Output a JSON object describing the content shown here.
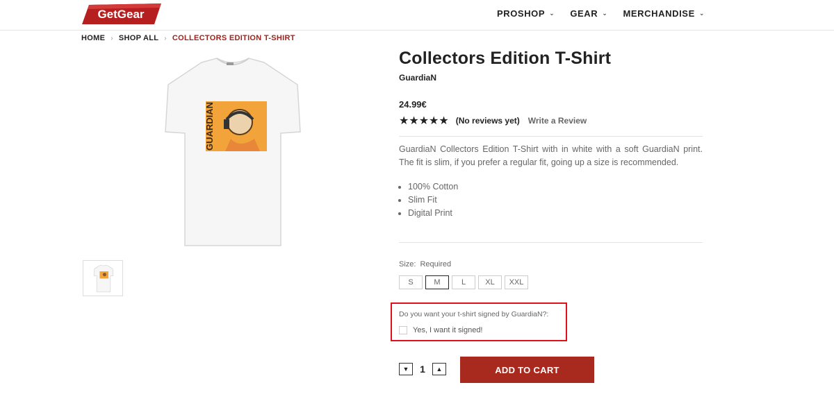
{
  "header": {
    "logo_text": "GetGear",
    "nav": [
      {
        "label": "PROSHOP"
      },
      {
        "label": "GEAR"
      },
      {
        "label": "MERCHANDISE"
      }
    ]
  },
  "breadcrumb": [
    "HOME",
    "SHOP ALL",
    "COLLECTORS EDITION T-SHIRT"
  ],
  "product": {
    "title": "Collectors Edition T-Shirt",
    "brand": "GuardiaN",
    "price": "24.99€",
    "stars": "★★★★★",
    "rating_value": 5,
    "reviews_text": "(No reviews yet)",
    "write_review": "Write a Review",
    "description": "GuardiaN Collectors Edition T-Shirt with in white with a soft GuardiaN print. The fit is slim, if you prefer a regular fit, going up a size is recommended.",
    "features": [
      "100% Cotton",
      "Slim Fit",
      "Digital Print"
    ],
    "print_text": "GUARDIAN"
  },
  "options": {
    "size_label": "Size:",
    "size_required": "Required",
    "sizes": [
      "S",
      "M",
      "L",
      "XL",
      "XXL"
    ],
    "selected_size": "M",
    "sign_question": "Do you want your t-shirt signed by GuardiaN?:",
    "sign_option": "Yes, I want it signed!"
  },
  "cart": {
    "quantity": "1",
    "add_to_cart": "ADD TO CART"
  },
  "colors": {
    "brand_red": "#a8291d",
    "highlight": "#e0101a",
    "print_orange": "#f2a43a"
  }
}
